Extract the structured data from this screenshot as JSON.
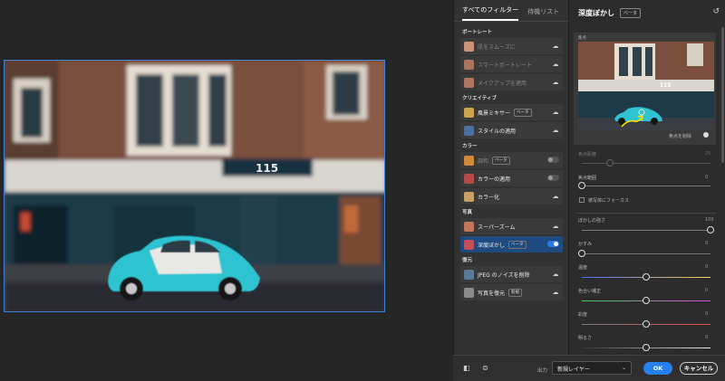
{
  "tabs": [
    {
      "label": "すべてのフィルター"
    },
    {
      "label": "待機リスト"
    }
  ],
  "filters": {
    "portrait": {
      "title": "ポートレート",
      "items": [
        {
          "label": "肌をスムーズに"
        },
        {
          "label": "スマートポートレート"
        },
        {
          "label": "メイクアップを適用"
        }
      ]
    },
    "creative": {
      "title": "クリエイティブ",
      "items": [
        {
          "label": "風景ミキサー",
          "badge": "ベータ"
        },
        {
          "label": "スタイルの適用"
        }
      ]
    },
    "color": {
      "title": "カラー",
      "items": [
        {
          "label": "調和",
          "badge": "ベータ"
        },
        {
          "label": "カラーの適用"
        },
        {
          "label": "カラー化"
        }
      ]
    },
    "photo": {
      "title": "写真",
      "items": [
        {
          "label": "スーパーズーム"
        },
        {
          "label": "深度ぼかし",
          "badge": "ベータ"
        }
      ]
    },
    "restore": {
      "title": "復元",
      "items": [
        {
          "label": "JPEG のノイズを削除"
        },
        {
          "label": "写真を復元",
          "badge": "新規"
        }
      ]
    }
  },
  "panel": {
    "title": "深度ぼかし",
    "badge": "ベータ",
    "focus_label": "焦点",
    "delete_focus": "焦点を削除",
    "focus_distance_label": "焦点距離",
    "focus_distance_value": "25",
    "focus_range_label": "焦点範囲",
    "focus_range_value": "0",
    "focus_subject_label": "被写体にフォーカス",
    "sliders": [
      {
        "label": "ぼかしの強さ",
        "value": "100",
        "level": 1.0
      },
      {
        "label": "かすみ",
        "value": "0",
        "level": 0.0
      },
      {
        "label": "温度",
        "value": "0",
        "level": 0.5
      },
      {
        "label": "色合い補正",
        "value": "0",
        "level": 0.5
      },
      {
        "label": "彩度",
        "value": "0",
        "level": 0.5
      },
      {
        "label": "明るさ",
        "value": "0",
        "level": 0.5
      }
    ]
  },
  "bottom": {
    "output_label": "出力",
    "output_value": "新規レイヤー",
    "ok": "OK",
    "cancel": "キャンセル"
  },
  "photo": {
    "sign_text": "115"
  },
  "colors": {
    "accent": "#2680eb",
    "car": "#2fc3d0",
    "annotation": "#f2e600"
  }
}
